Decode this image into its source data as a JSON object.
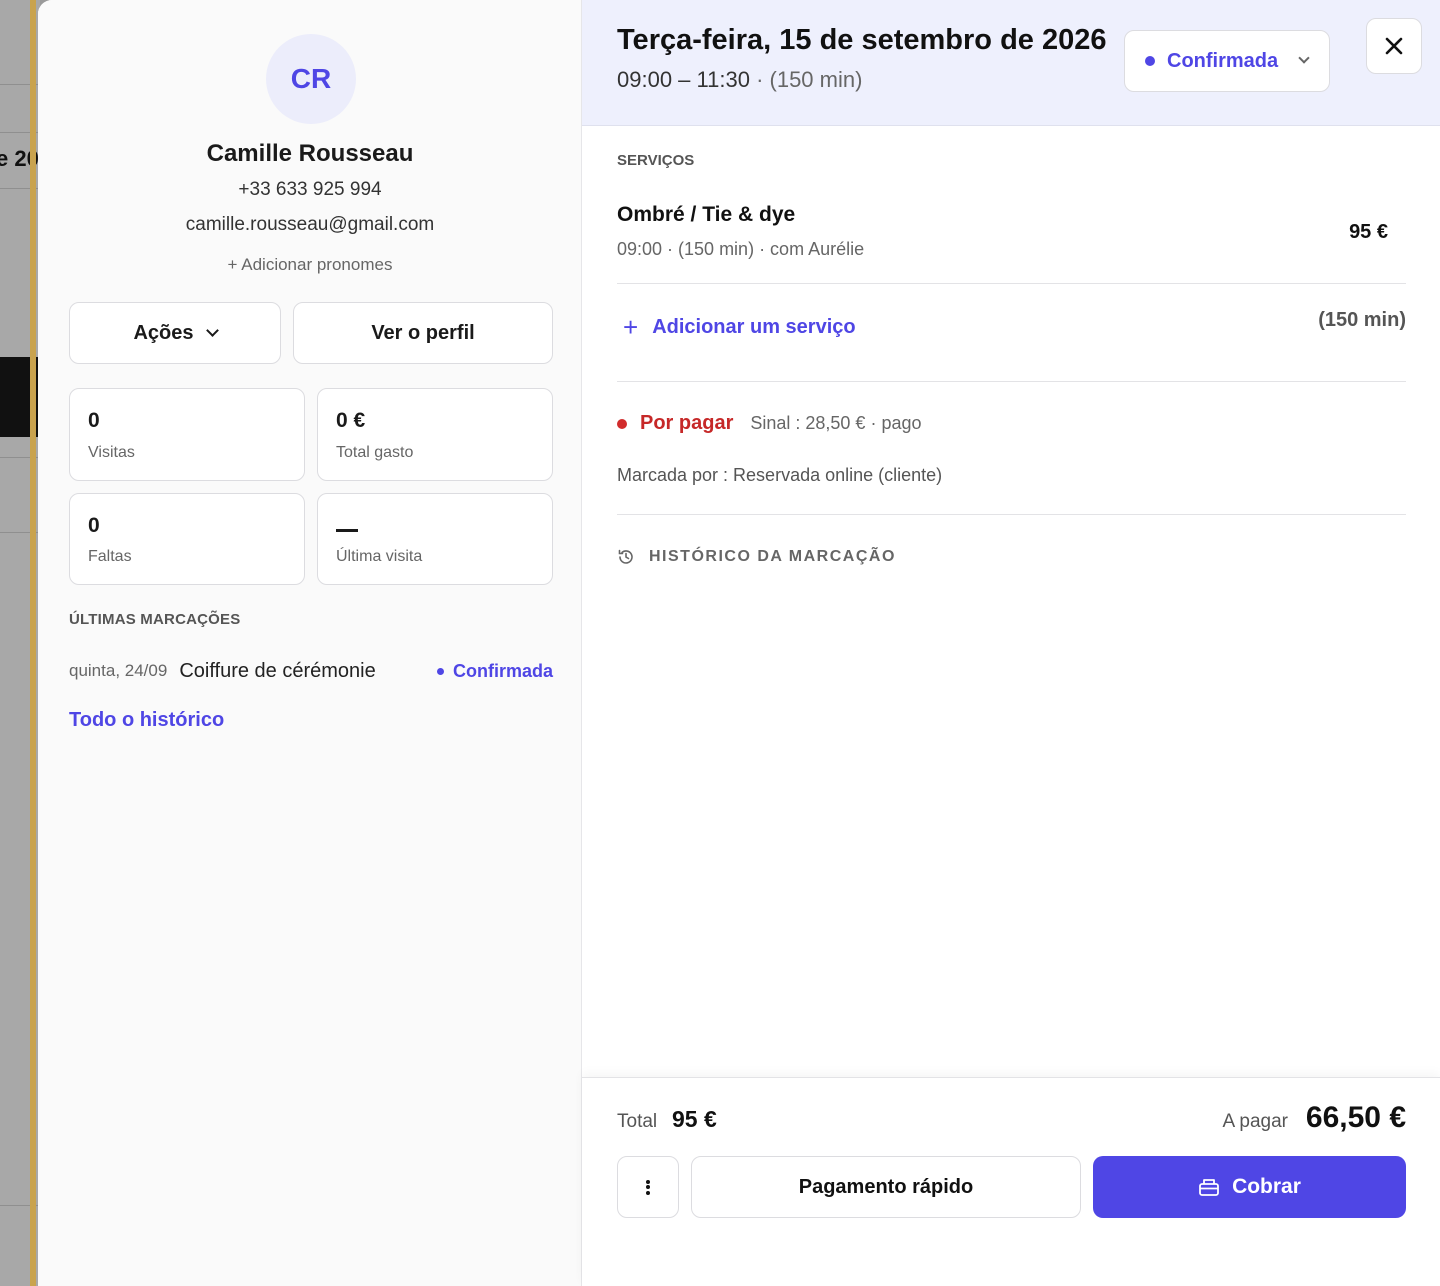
{
  "background": {
    "year_fragment": "e 20"
  },
  "client": {
    "initials": "CR",
    "name": "Camille Rousseau",
    "phone": "+33 633 925 994",
    "email": "camille.rousseau@gmail.com",
    "add_pronouns": "+ Adicionar pronomes",
    "actions_label": "Ações",
    "view_profile_label": "Ver o perfil",
    "stats": [
      {
        "value": "0",
        "label": "Visitas"
      },
      {
        "value": "0 €",
        "label": "Total gasto"
      },
      {
        "value": "0",
        "label": "Faltas"
      },
      {
        "value": "",
        "label": "Última visita"
      }
    ],
    "recent_title": "ÚLTIMAS MARCAÇÕES",
    "recent": [
      {
        "date": "quinta, 24/09",
        "service": "Coiffure de cérémonie",
        "status": "Confirmada"
      }
    ],
    "history_link": "Todo o histórico"
  },
  "appointment": {
    "date": "Terça-feira, 15 de setembro de 2026",
    "time": "09:00 – 11:30",
    "duration": "· (150 min)",
    "status": "Confirmada",
    "services_title": "SERVIÇOS",
    "services": [
      {
        "name": "Ombré / Tie & dye",
        "meta": "09:00 · (150 min) · com Aurélie",
        "price": "95 €"
      }
    ],
    "add_service": "Adicionar um serviço",
    "total_duration": "(150 min)",
    "payment_status": "Por pagar",
    "deposit": "Sinal : 28,50 € · pago",
    "booked_by": "Marcada por : Reservada online (cliente)",
    "history_title": "HISTÓRICO DA MARCAÇÃO"
  },
  "footer": {
    "total_label": "Total",
    "total_value": "95 €",
    "due_label": "A pagar",
    "due_value": "66,50 €",
    "quick_pay": "Pagamento rápido",
    "charge": "Cobrar"
  },
  "colors": {
    "accent": "#4f46e5",
    "danger": "#c62828",
    "header_bg": "#eef0fd"
  },
  "icons": [
    "chevron-down-icon",
    "close-icon",
    "plus-icon",
    "history-icon",
    "more-vertical-icon",
    "register-icon"
  ]
}
